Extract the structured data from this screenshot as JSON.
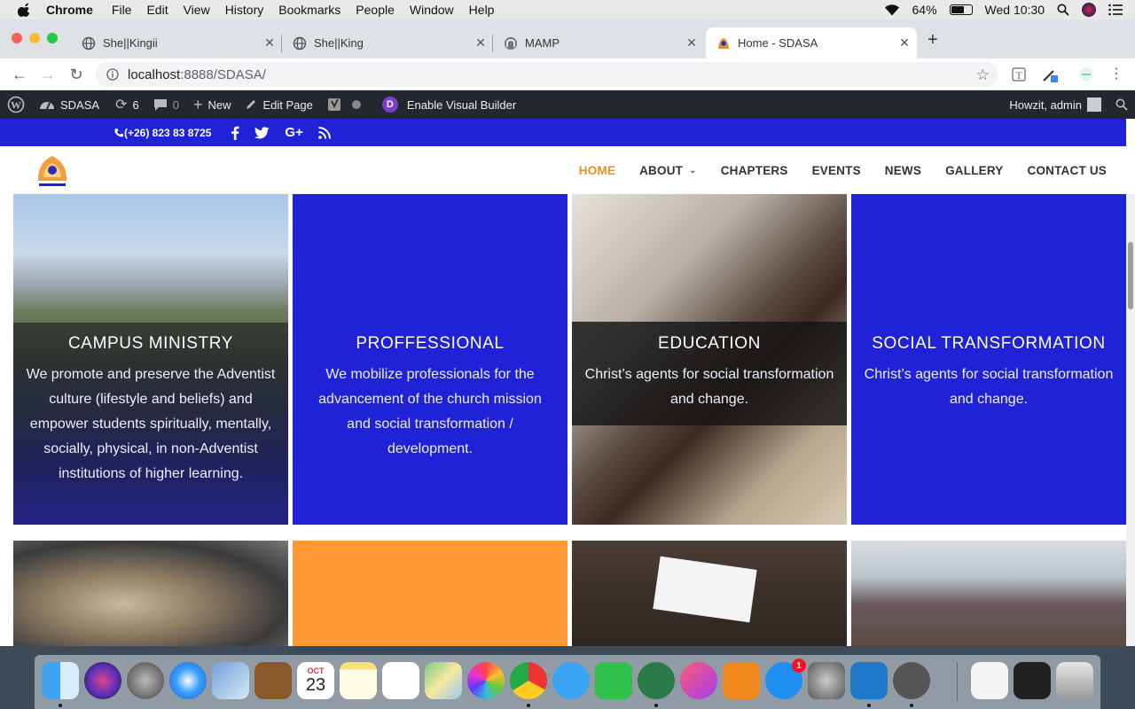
{
  "menubar": {
    "app_name": "Chrome",
    "items": [
      "File",
      "Edit",
      "View",
      "History",
      "Bookmarks",
      "People",
      "Window",
      "Help"
    ],
    "battery": "64%",
    "clock": "Wed 10:30"
  },
  "tabs": [
    {
      "title": "She||Kingii",
      "icon": "globe-icon"
    },
    {
      "title": "She||King",
      "icon": "globe-icon"
    },
    {
      "title": "MAMP",
      "icon": "mamp-icon"
    },
    {
      "title": "Home - SDASA",
      "icon": "sdasa-icon",
      "active": true
    }
  ],
  "toolbar": {
    "url_host": "localhost",
    "url_path": ":8888/SDASA/"
  },
  "wpbar": {
    "site_name": "SDASA",
    "updates_count": "6",
    "comments_count": "0",
    "new_label": "New",
    "edit_label": "Edit Page",
    "builder_label": "Enable Visual Builder",
    "divi_letter": "D",
    "greeting": "Howzit, admin"
  },
  "topbar": {
    "phone": "(+26) 823 83 8725",
    "social": [
      "facebook-icon",
      "twitter-icon",
      "google-plus-icon",
      "rss-icon"
    ]
  },
  "nav": {
    "items": [
      "HOME",
      "ABOUT",
      "CHAPTERS",
      "EVENTS",
      "NEWS",
      "GALLERY",
      "CONTACT US"
    ],
    "active": "HOME"
  },
  "cards": [
    {
      "title": "CAMPUS MINISTRY",
      "desc": "We promote and preserve the Adventist culture (lifestyle and beliefs) and empower students spiritually, mentally, socially, physical, in non-Adventist institutions of higher learning."
    },
    {
      "title": "PROFFESSIONAL",
      "desc": "We mobilize professionals for the advancement of the church mission and social transformation / development."
    },
    {
      "title": "EDUCATION",
      "desc": "Christ’s agents for social transformation and change."
    },
    {
      "title": "SOCIAL TRANSFORMATION",
      "desc": "Christ’s agents for social transformation and change."
    }
  ],
  "colors": {
    "brand_blue": "#1f22d7",
    "accent_orange": "#e0922a",
    "wp_bar": "#23282d"
  },
  "dock": {
    "calendar_month": "OCT",
    "calendar_day": "23",
    "appstore_badge": "1"
  }
}
